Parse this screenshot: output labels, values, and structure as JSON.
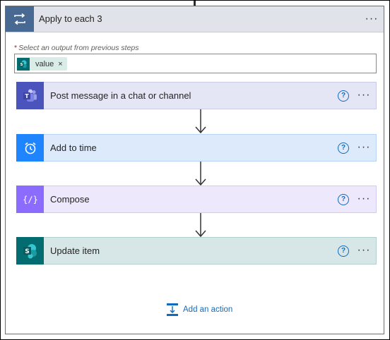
{
  "loop": {
    "title": "Apply to each 3",
    "more": "···",
    "select_required_mark": "*",
    "select_label": "Select an output from previous steps",
    "token": {
      "text": "value",
      "close": "×"
    }
  },
  "actions": [
    {
      "title": "Post message in a chat or channel",
      "help": "?",
      "more": "···",
      "icon": "teams-icon",
      "color": "#4b53bc"
    },
    {
      "title": "Add to time",
      "help": "?",
      "more": "···",
      "icon": "alarm-clock-icon",
      "color": "#1f85ff"
    },
    {
      "title": "Compose",
      "help": "?",
      "more": "···",
      "icon": "compose-curly-braces-icon",
      "color": "#8c6cff"
    },
    {
      "title": "Update item",
      "help": "?",
      "more": "···",
      "icon": "sharepoint-icon",
      "color": "#036c70"
    }
  ],
  "add_action": {
    "label": "Add an action",
    "icon": "add-action-icon"
  },
  "colors": {
    "loop_header_bg": "#e1e3ea",
    "loop_icon_bg": "#486991",
    "teams_bg": "#e4e6f6",
    "time_bg": "#dceafb",
    "compose_bg": "#ede8fb",
    "sharepoint_bg": "#d7e7e7",
    "link": "#0f6cbd"
  }
}
